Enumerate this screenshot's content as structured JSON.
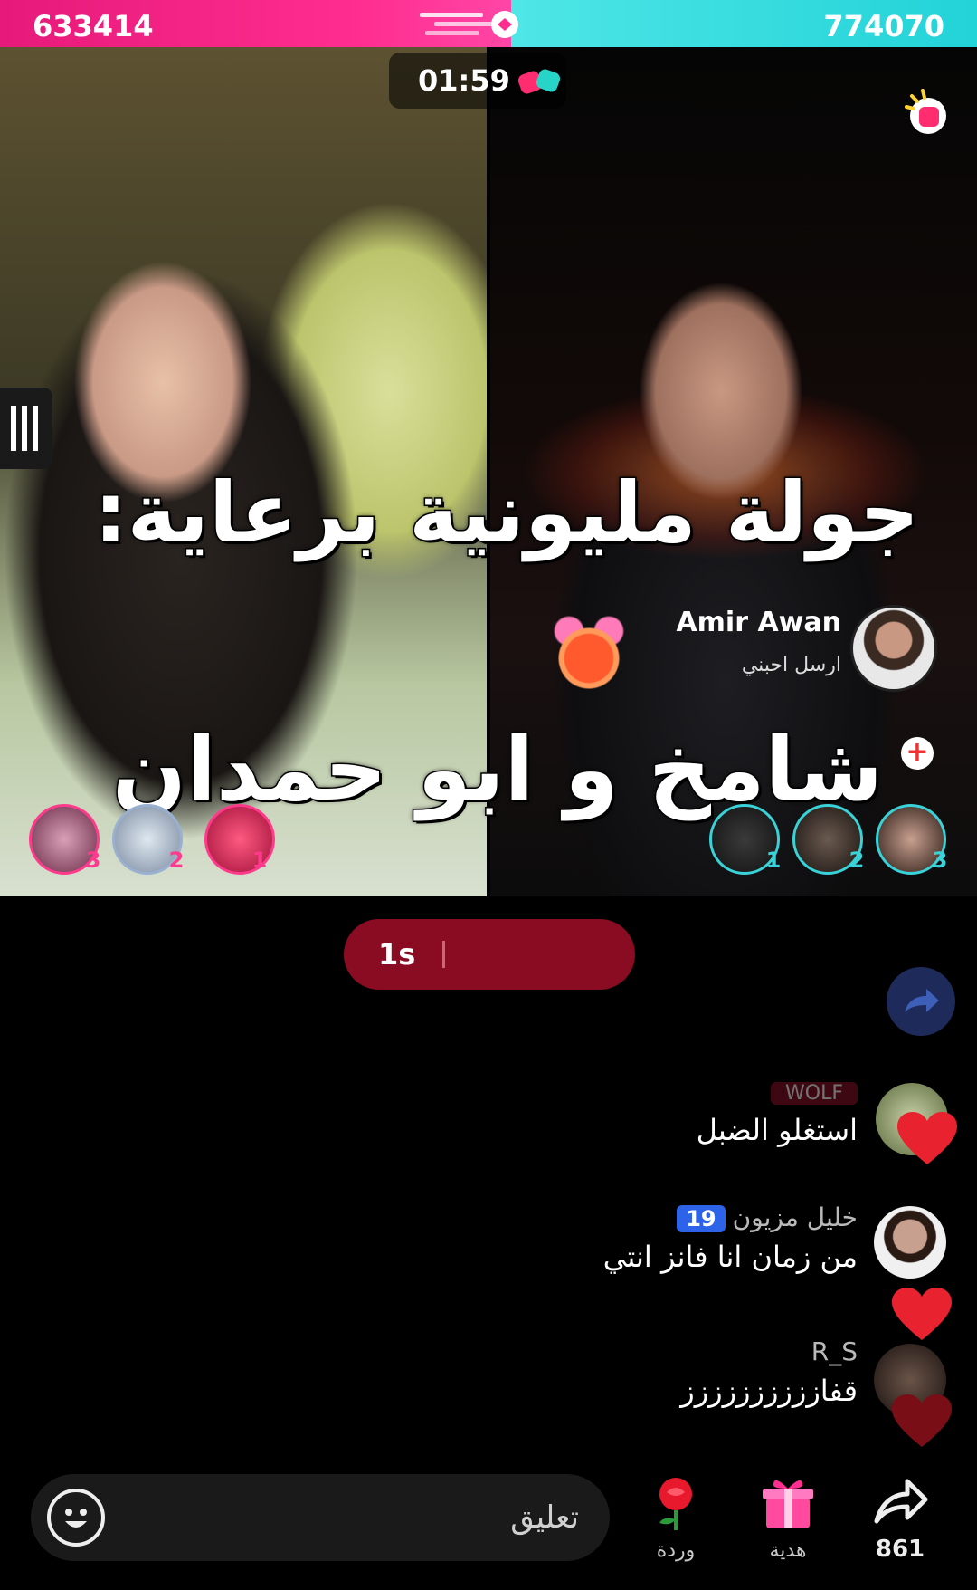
{
  "battle": {
    "left_score": "633414",
    "right_score": "774070",
    "timer": "01:59",
    "colors": {
      "left": "#ff2d8f",
      "right": "#22d3d8",
      "result_pill": "#8a0c22"
    }
  },
  "overlay_caption": {
    "line1": "جولة مليونية برعاية:",
    "line2": "شامخ و ابو حمدان"
  },
  "opponent_host": {
    "name": "Amir Awan",
    "subtitle": "ارسل احبني"
  },
  "left_supporters": [
    {
      "rank": "3"
    },
    {
      "rank": "2"
    },
    {
      "rank": "1"
    }
  ],
  "right_supporters": [
    {
      "rank": "1"
    },
    {
      "rank": "2"
    },
    {
      "rank": "3"
    }
  ],
  "result_pill": {
    "label": "1s"
  },
  "comments": [
    {
      "name": "WOLF",
      "text": "استغلو الضبل"
    },
    {
      "name": "خليل مزيون",
      "level": "19",
      "text": "من زمان انا فانز انتي"
    },
    {
      "name": "R_S",
      "text": "قفازززززززززز"
    }
  ],
  "bottom_bar": {
    "comment_placeholder": "تعليق",
    "rose_label": "وردة",
    "gift_label": "هدية",
    "share_count": "861"
  },
  "icons": [
    "speed-streak-icon",
    "vs-gloves-icon",
    "booster-icon",
    "mic-icon",
    "plus-icon",
    "share-icon",
    "heart-icon",
    "emoji-icon",
    "rose-icon",
    "gift-icon"
  ]
}
